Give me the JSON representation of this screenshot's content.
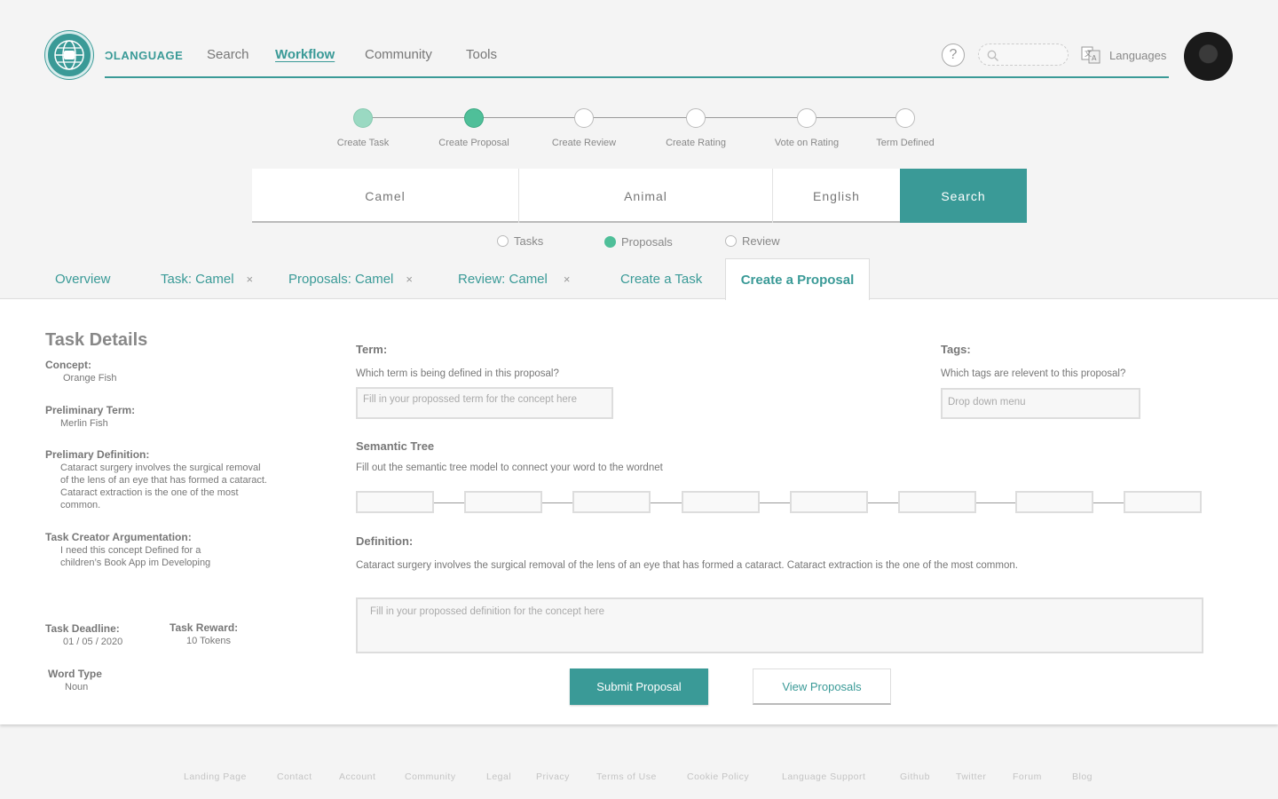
{
  "header": {
    "brand": "ƆLANGUAGE",
    "nav": [
      "Search",
      "Workflow",
      "Community",
      "Tools"
    ],
    "active_nav": "Workflow",
    "help": "?",
    "languages_label": "Languages"
  },
  "stepper": {
    "steps": [
      {
        "label": "Create Task",
        "state": "done-light"
      },
      {
        "label": "Create Proposal",
        "state": "done"
      },
      {
        "label": "Create Review",
        "state": "pending"
      },
      {
        "label": "Create Rating",
        "state": "pending"
      },
      {
        "label": "Vote on Rating",
        "state": "pending"
      },
      {
        "label": "Term Defined",
        "state": "pending"
      }
    ]
  },
  "search": {
    "term": "Camel",
    "category": "Animal",
    "language": "English",
    "button": "Search"
  },
  "filters": [
    {
      "label": "Tasks",
      "checked": false
    },
    {
      "label": "Proposals",
      "checked": true
    },
    {
      "label": "Review",
      "checked": false
    }
  ],
  "tabs": [
    {
      "label": "Overview",
      "closable": false
    },
    {
      "label": "Task: Camel",
      "closable": true
    },
    {
      "label": "Proposals: Camel",
      "closable": true
    },
    {
      "label": "Review: Camel",
      "closable": true
    },
    {
      "label": "Create a Task",
      "closable": false
    }
  ],
  "active_tab": "Create a Proposal",
  "close_glyph": "×",
  "task": {
    "title": "Task Details",
    "concept_label": "Concept:",
    "concept": "Orange Fish",
    "prelim_term_label": "Preliminary Term:",
    "prelim_term": "Merlin Fish",
    "prelim_def_label": "Prelimary Definition:",
    "prelim_def_lines": [
      "Cataract surgery involves the surgical removal",
      "of the lens of an eye that has formed a cataract.",
      "Cataract extraction is the one of the most",
      "common."
    ],
    "argument_label": "Task Creator Argumentation:",
    "argument_lines": [
      "I need this concept Defined for a",
      "children’s Book App im Developing"
    ],
    "deadline_label": "Task Deadline:",
    "deadline": "01 / 05 / 2020",
    "reward_label": "Task Reward:",
    "reward": "10 Tokens",
    "wordtype_label": "Word Type",
    "wordtype": "Noun"
  },
  "form": {
    "term_label": "Term:",
    "term_help": "Which term is being defined in this proposal?",
    "term_placeholder": "Fill in your propossed term for the concept here",
    "tags_label": "Tags:",
    "tags_help": "Which tags are relevent to this proposal?",
    "tags_placeholder": "Drop down menu",
    "tree_label": "Semantic Tree",
    "tree_help": "Fill out the semantic tree model to connect your word to the wordnet",
    "definition_label": "Definition:",
    "definition_text": "Cataract surgery involves the surgical removal of the lens of an eye that has formed a cataract. Cataract extraction is the one of the most common.",
    "definition_placeholder": "Fill in your propossed definition for the concept here",
    "submit": "Submit Proposal",
    "view": "View Proposals"
  },
  "footer": [
    "Landing Page",
    "Contact",
    "Account",
    "Community",
    "Legal",
    "Privacy",
    "Terms of Use",
    "Cookie Policy",
    "Language Support",
    "Github",
    "Twitter",
    "Forum",
    "Blog"
  ],
  "colors": {
    "accent": "#3a9a97",
    "step_done": "#4fbf99",
    "step_done_light": "#9ad9c2"
  }
}
